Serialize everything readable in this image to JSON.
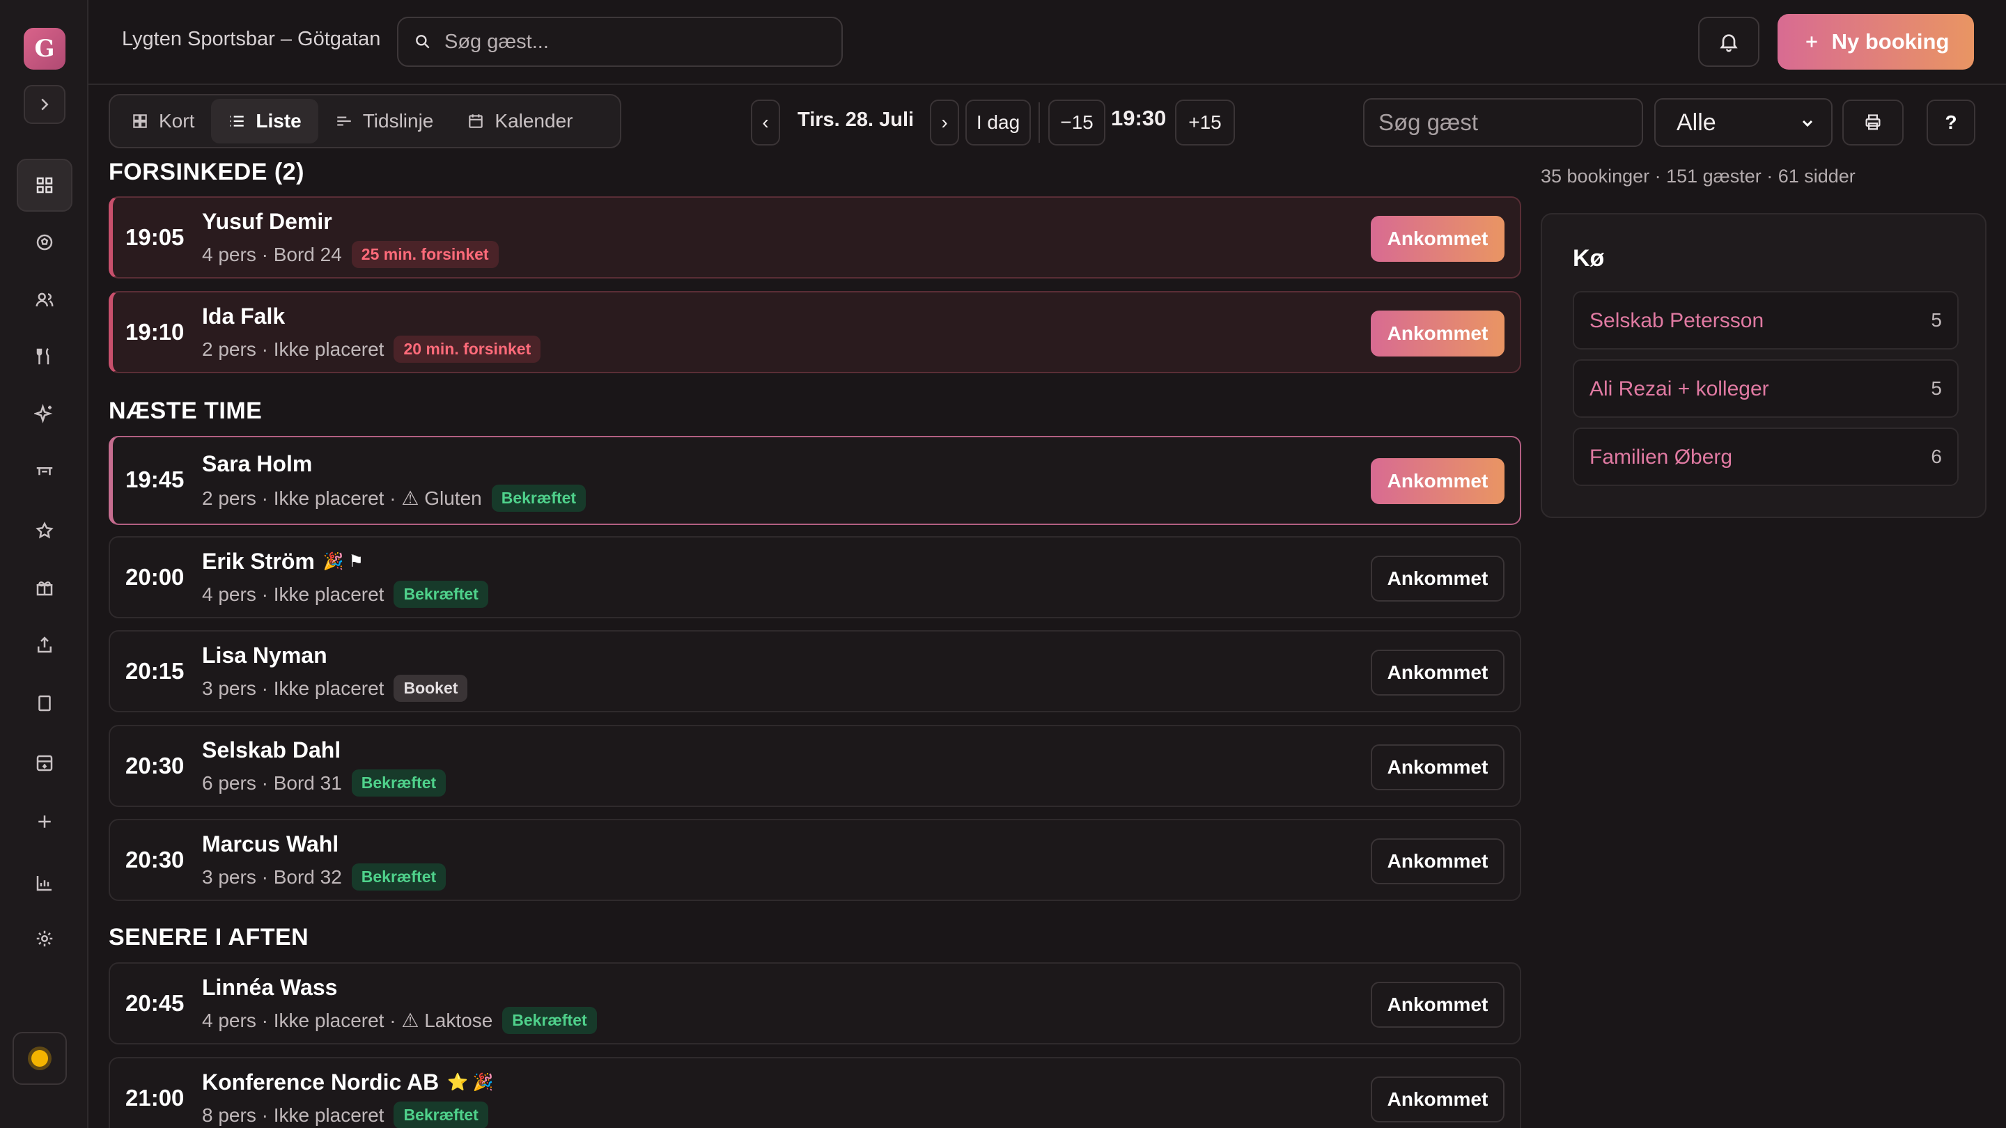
{
  "app": {
    "logo_letter": "G",
    "venue": "Lygten Sportsbar – Götgatan"
  },
  "top_search": {
    "placeholder": "Søg gæst..."
  },
  "new_booking_label": "Ny booking",
  "view_tabs": [
    {
      "label": "Kort",
      "icon": "grid-icon"
    },
    {
      "label": "Liste",
      "icon": "list-icon"
    },
    {
      "label": "Tidslinje",
      "icon": "timeline-icon"
    },
    {
      "label": "Kalender",
      "icon": "calendar-icon"
    }
  ],
  "date_nav": {
    "prev": "‹",
    "next": "›",
    "date": "Tirs. 28. Juli",
    "today": "I dag",
    "minus": "−15",
    "time": "19:30",
    "plus": "+15"
  },
  "guest_search": {
    "placeholder": "Søg gæst"
  },
  "filter": {
    "selected": "Alle"
  },
  "help_label": "?",
  "stats": "35 bookinger · 151 gæster · 61 sidder",
  "sections": {
    "late_title": "FORSINKEDE (2)",
    "next_title": "NÆSTE TIME",
    "later_title": "SENERE I AFTEN"
  },
  "arrive_label": "Ankommet",
  "bookings": [
    {
      "time": "19:05",
      "name": "Yusuf Demir",
      "meta": "4 pers · Bord 24",
      "badge": "25 min. forsinket"
    },
    {
      "time": "19:10",
      "name": "Ida Falk",
      "meta": "2 pers · Ikke placeret",
      "badge": "20 min. forsinket"
    },
    {
      "time": "19:45",
      "name": "Sara Holm",
      "meta": "2 pers · Ikke placeret · ⚠ Gluten",
      "badge": "Bekræftet"
    },
    {
      "time": "20:00",
      "name": "Erik Ström",
      "meta": "4 pers · Ikke placeret",
      "badge": "Bekræftet",
      "icons": "🎉 ⚑"
    },
    {
      "time": "20:15",
      "name": "Lisa Nyman",
      "meta": "3 pers · Ikke placeret",
      "badge": "Booket"
    },
    {
      "time": "20:30",
      "name": "Selskab Dahl",
      "meta": "6 pers · Bord 31",
      "badge": "Bekræftet"
    },
    {
      "time": "20:30",
      "name": "Marcus Wahl",
      "meta": "3 pers · Bord 32",
      "badge": "Bekræftet"
    },
    {
      "time": "20:45",
      "name": "Linnéa Wass",
      "meta": "4 pers · Ikke placeret · ⚠ Laktose",
      "badge": "Bekræftet"
    },
    {
      "time": "21:00",
      "name": "Konference Nordic AB",
      "meta": "8 pers · Ikke placeret",
      "badge": "Bekræftet",
      "icons": "⭐ 🎉"
    }
  ],
  "queue": {
    "title": "Kø",
    "items": [
      {
        "name": "Selskab Petersson",
        "count": "5"
      },
      {
        "name": "Ali Rezai + kolleger",
        "count": "5"
      },
      {
        "name": "Familien Øberg",
        "count": "6"
      }
    ]
  },
  "colors": {
    "accent": "#d86b92",
    "accent2": "#e99563",
    "late": "#ff6b7a",
    "ok": "#4fd18b",
    "bg": "#1a1618"
  }
}
